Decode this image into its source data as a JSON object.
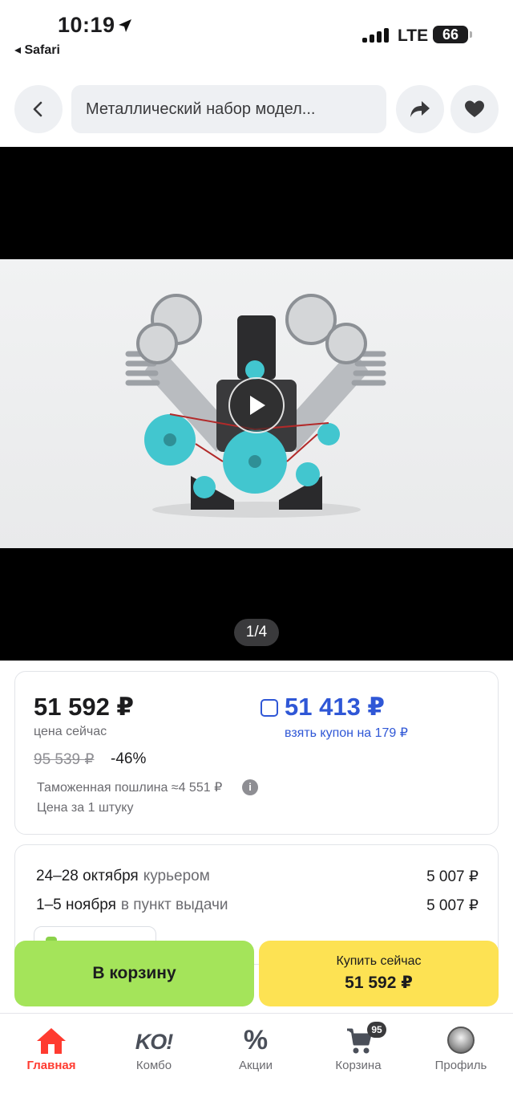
{
  "status_bar": {
    "time": "10:19",
    "back_app": "◂ Safari",
    "network": "LTE",
    "battery": "66"
  },
  "nav": {
    "search_text": "Металлический набор модел..."
  },
  "media": {
    "counter": "1/4"
  },
  "price": {
    "current": "51 592 ₽",
    "current_label": "цена сейчас",
    "coupon_price": "51 413 ₽",
    "coupon_label": "взять купон на 179 ₽",
    "old_price": "95 539 ₽",
    "discount": "-46%",
    "duty": "Таможенная пошлина ≈4 551 ₽",
    "per_unit": "Цена за 1 штуку"
  },
  "delivery": [
    {
      "dates": "24–28 октября",
      "method": "курьером",
      "cost": "5 007 ₽"
    },
    {
      "dates": "1–5 ноября",
      "method": "в пункт выдачи",
      "cost": "5 007 ₽"
    }
  ],
  "actions": {
    "cart_label": "В корзину",
    "buy_label": "Купить сейчас",
    "buy_price": "51 592 ₽"
  },
  "tabs": [
    {
      "label": "Главная",
      "icon": "home-icon",
      "active": true
    },
    {
      "label": "Комбо",
      "icon": "ko-logo-icon",
      "logo_text": "KO!"
    },
    {
      "label": "Акции",
      "icon": "percent-icon",
      "glyph": "%"
    },
    {
      "label": "Корзина",
      "icon": "cart-icon",
      "badge": "95"
    },
    {
      "label": "Профиль",
      "icon": "avatar-icon"
    }
  ],
  "colors": {
    "accent_blue": "#2f57d6",
    "cart_button": "#a4e45a",
    "buy_button": "#fde253",
    "active_tab": "#ff3b30"
  }
}
